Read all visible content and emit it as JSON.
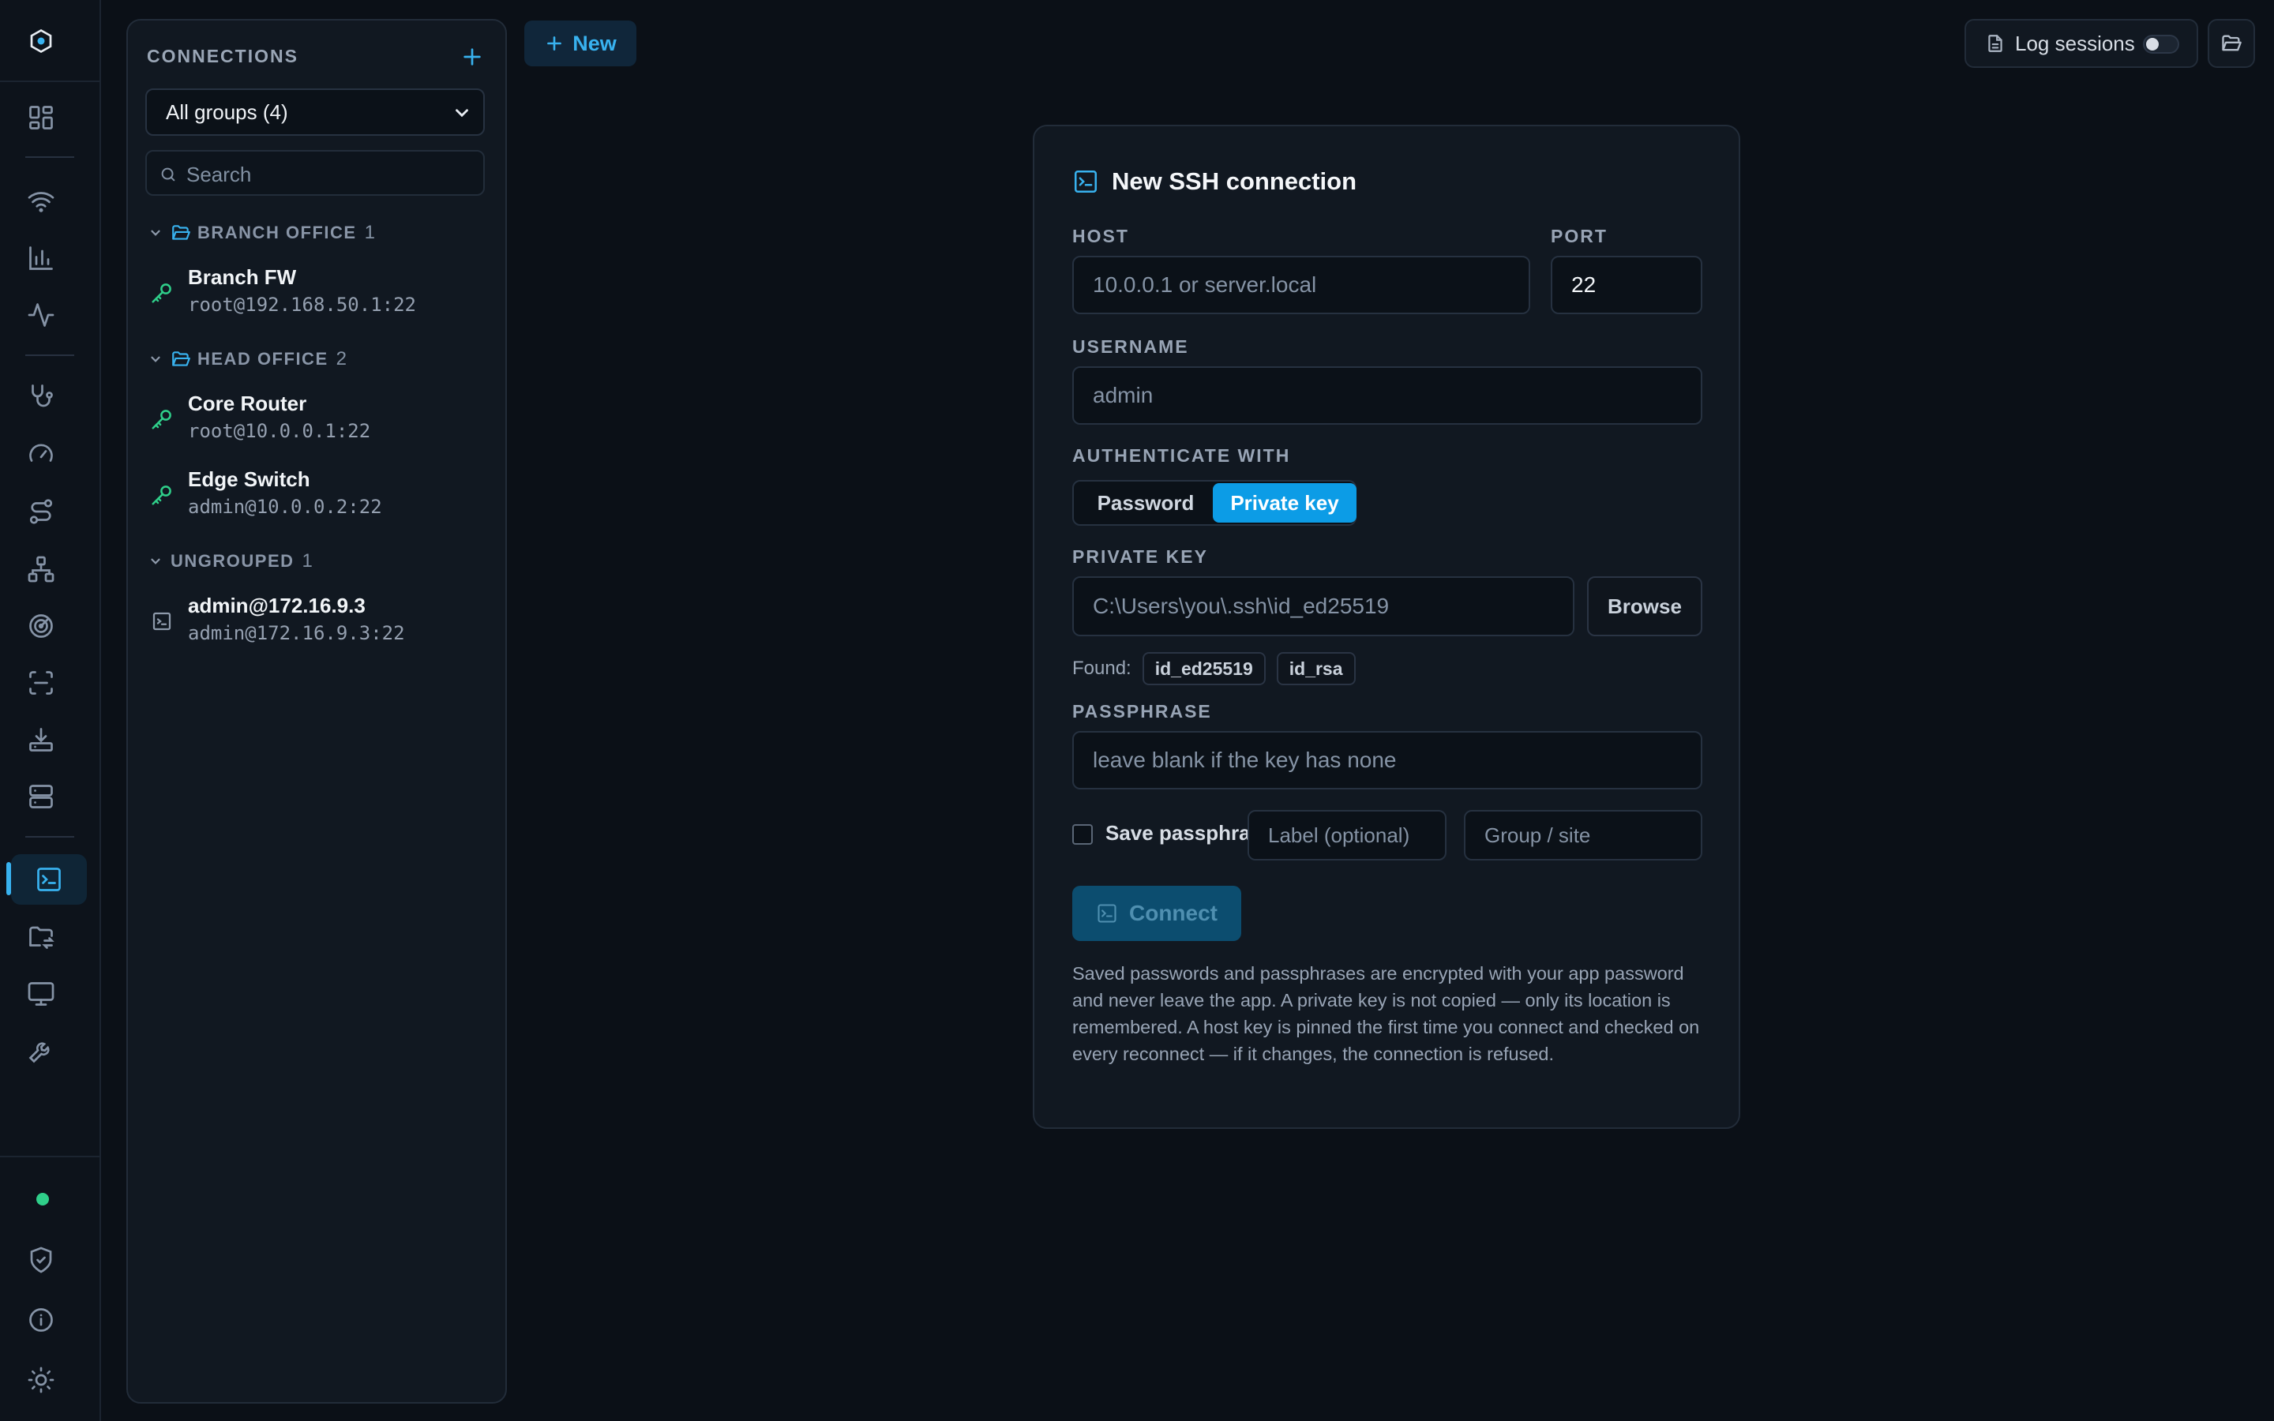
{
  "rail": {
    "items": [
      {
        "name": "dashboard-icon"
      },
      {
        "name": "wifi-icon"
      },
      {
        "name": "bar-chart-icon"
      },
      {
        "name": "activity-icon"
      },
      {
        "name": "stethoscope-icon"
      },
      {
        "name": "gauge-icon"
      },
      {
        "name": "route-icon"
      },
      {
        "name": "network-icon"
      },
      {
        "name": "radar-icon"
      },
      {
        "name": "scan-icon"
      },
      {
        "name": "download-icon"
      },
      {
        "name": "server-icon"
      },
      {
        "name": "terminal-icon",
        "active": true
      },
      {
        "name": "folder-sync-icon"
      },
      {
        "name": "monitor-icon"
      },
      {
        "name": "tools-icon"
      }
    ],
    "status_color": "#2fcf8a",
    "bottom": [
      {
        "name": "shield-check-icon"
      },
      {
        "name": "info-icon"
      },
      {
        "name": "sun-icon"
      }
    ]
  },
  "panel": {
    "title": "CONNECTIONS",
    "group_select": "All groups (4)",
    "search_placeholder": "Search",
    "groups": [
      {
        "name": "BRANCH OFFICE",
        "count": "1",
        "folder": true,
        "items": [
          {
            "name": "Branch FW",
            "address": "root@192.168.50.1:22",
            "icon": "key-icon"
          }
        ]
      },
      {
        "name": "HEAD OFFICE",
        "count": "2",
        "folder": true,
        "items": [
          {
            "name": "Core Router",
            "address": "root@10.0.0.1:22",
            "icon": "key-icon"
          },
          {
            "name": "Edge Switch",
            "address": "admin@10.0.0.2:22",
            "icon": "key-icon"
          }
        ]
      },
      {
        "name": "UNGROUPED",
        "count": "1",
        "folder": false,
        "items": [
          {
            "name": "admin@172.16.9.3",
            "address": "admin@172.16.9.3:22",
            "icon": "terminal-icon"
          }
        ]
      }
    ]
  },
  "topbar": {
    "new_label": "New",
    "log_sessions_label": "Log sessions",
    "log_sessions_enabled": false
  },
  "form": {
    "title": "New SSH connection",
    "host_label": "HOST",
    "host_placeholder": "10.0.0.1 or server.local",
    "port_label": "PORT",
    "port_value": "22",
    "username_label": "USERNAME",
    "username_placeholder": "admin",
    "auth_label": "AUTHENTICATE WITH",
    "auth_options": [
      "Password",
      "Private key"
    ],
    "auth_selected": "Private key",
    "private_key_label": "PRIVATE KEY",
    "private_key_placeholder": "C:\\Users\\you\\.ssh\\id_ed25519",
    "browse_label": "Browse",
    "found_label": "Found:",
    "found_keys": [
      "id_ed25519",
      "id_rsa"
    ],
    "passphrase_label": "PASSPHRASE",
    "passphrase_placeholder": "leave blank if the key has none",
    "save_passphrase_label": "Save passphrase",
    "save_passphrase_checked": false,
    "label_placeholder": "Label (optional)",
    "group_placeholder": "Group / site",
    "connect_label": "Connect",
    "note": "Saved passwords and passphrases are encrypted with your app password and never leave the app. A private key is not copied — only its location is remembered. A host key is pinned the first time you connect and checked on every reconnect — if it changes, the connection is refused."
  },
  "colors": {
    "accent": "#38b2ef",
    "accent_button": "#0c9ce6",
    "background": "#0b1017",
    "key_icon": "#2fcf8a"
  }
}
